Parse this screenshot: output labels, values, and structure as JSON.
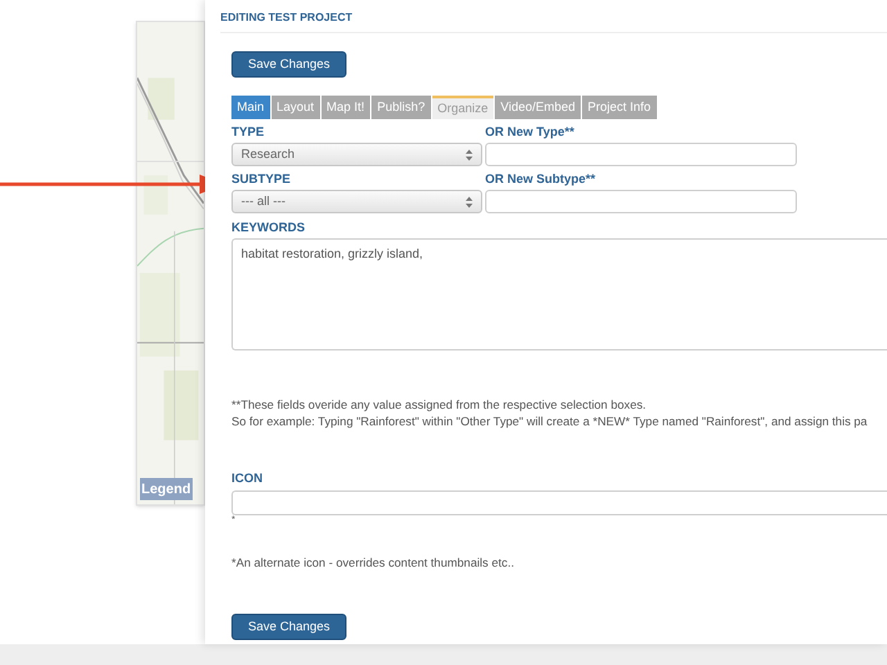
{
  "map": {
    "legend_button": "Legend"
  },
  "editor": {
    "title": "EDITING TEST PROJECT",
    "save_button_top": "Save Changes",
    "tabs": [
      {
        "label": "Main",
        "selected": true,
        "hovered": false
      },
      {
        "label": "Layout",
        "selected": false,
        "hovered": false
      },
      {
        "label": "Map It!",
        "selected": false,
        "hovered": false
      },
      {
        "label": "Publish?",
        "selected": false,
        "hovered": false
      },
      {
        "label": "Organize",
        "selected": false,
        "hovered": true
      },
      {
        "label": "Video/Embed",
        "selected": false,
        "hovered": false
      },
      {
        "label": "Project Info",
        "selected": false,
        "hovered": false
      }
    ],
    "type": {
      "label": "TYPE",
      "value": "Research",
      "new_label": "OR New Type**"
    },
    "subtype": {
      "label": "SUBTYPE",
      "value": "--- all ---",
      "new_label": "OR New Subtype**"
    },
    "keywords": {
      "label": "KEYWORDS",
      "value": "habitat restoration, grizzly island,"
    },
    "notes": [
      "**These fields overide any value assigned from the respective selection boxes.",
      "So for example: Typing \"Rainforest\" within \"Other Type\" will create a *NEW* Type named \"Rainforest\", and assign this pa"
    ],
    "icon": {
      "label": "ICON",
      "footnote_mark": "*",
      "note": "*An alternate icon - overrides content thumbnails etc.."
    },
    "save_button_bottom": "Save Changes"
  }
}
